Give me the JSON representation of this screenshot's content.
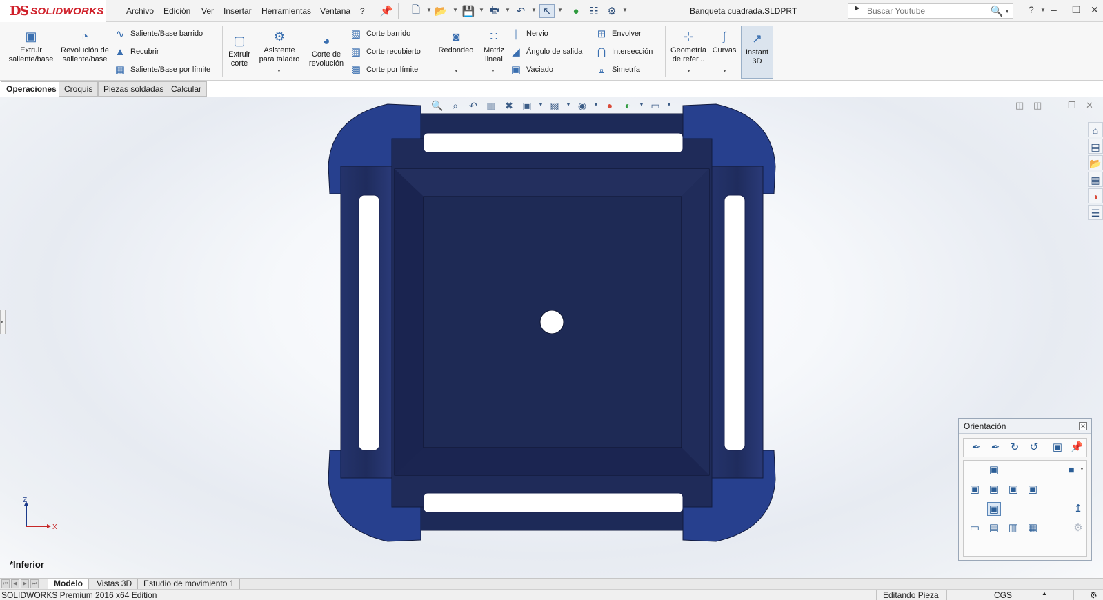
{
  "app": {
    "logo_text": "SOLIDWORKS",
    "logo_mark": "DS"
  },
  "menu": [
    "Archivo",
    "Edición",
    "Ver",
    "Insertar",
    "Herramientas",
    "Ventana",
    "?"
  ],
  "document_title": "Banqueta cuadrada.SLDPRT",
  "search": {
    "placeholder": "Buscar Youtube",
    "provider_icon": "youtube-icon"
  },
  "ribbon": {
    "features": {
      "extrude_boss": "Extruir saliente/base",
      "revolve_boss": "Revolución de saliente/base",
      "swept_boss": "Saliente/Base barrido",
      "loft": "Recubrir",
      "boundary_boss": "Saliente/Base por límite",
      "extrude_cut": "Extruir corte",
      "hole_wizard": "Asistente para taladro",
      "revolve_cut": "Corte de revolución",
      "swept_cut": "Corte barrido",
      "lofted_cut": "Corte recubierto",
      "boundary_cut": "Corte por límite",
      "fillet": "Redondeo",
      "linear_pattern": "Matriz lineal",
      "rib": "Nervio",
      "draft": "Ángulo de salida",
      "shell": "Vaciado",
      "wrap": "Envolver",
      "intersect": "Intersección",
      "mirror": "Simetría",
      "reference_geometry": "Geometría de refer...",
      "curves": "Curvas",
      "instant3d": "Instant 3D"
    }
  },
  "command_tabs": [
    {
      "label": "Operaciones",
      "active": true
    },
    {
      "label": "Croquis",
      "active": false
    },
    {
      "label": "Piezas soldadas",
      "active": false
    },
    {
      "label": "Calcular",
      "active": false
    }
  ],
  "viewport": {
    "view_name": "*Inferior",
    "triad": {
      "axis_vertical": "Z",
      "axis_horizontal": "X"
    },
    "model_color": "#1e2a55",
    "model_edge_color": "#27408e"
  },
  "orientation_dialog": {
    "title": "Orientación"
  },
  "bottom_tabs": [
    {
      "label": "Modelo",
      "active": true
    },
    {
      "label": "Vistas 3D",
      "active": false
    },
    {
      "label": "Estudio de movimiento 1",
      "active": false
    }
  ],
  "status": {
    "edition": "SOLIDWORKS Premium 2016 x64 Edition",
    "mode": "Editando Pieza",
    "units": "CGS"
  }
}
